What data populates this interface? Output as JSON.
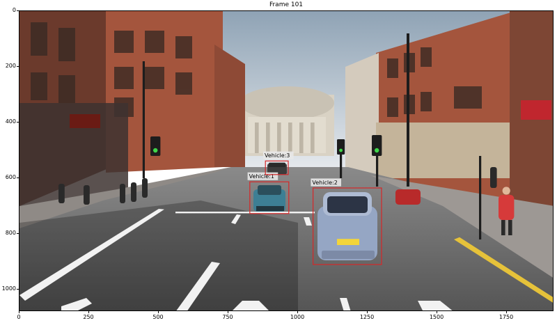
{
  "title": "Frame 101",
  "image": {
    "width": 1920,
    "height": 1080,
    "description_semantic": "street-scene-frame"
  },
  "x_ticks": [
    {
      "value": 0,
      "label": "0"
    },
    {
      "value": 250,
      "label": "250"
    },
    {
      "value": 500,
      "label": "500"
    },
    {
      "value": 750,
      "label": "750"
    },
    {
      "value": 1000,
      "label": "1000"
    },
    {
      "value": 1250,
      "label": "1250"
    },
    {
      "value": 1500,
      "label": "1500"
    },
    {
      "value": 1750,
      "label": "1750"
    }
  ],
  "y_ticks": [
    {
      "value": 0,
      "label": "0"
    },
    {
      "value": 200,
      "label": "200"
    },
    {
      "value": 400,
      "label": "400"
    },
    {
      "value": 600,
      "label": "600"
    },
    {
      "value": 800,
      "label": "800"
    },
    {
      "value": 1000,
      "label": "1000"
    }
  ],
  "detections": [
    {
      "label": "Vehicle:1",
      "x1": 827,
      "y1": 613,
      "x2": 967,
      "y2": 727
    },
    {
      "label": "Vehicle:2",
      "x1": 1054,
      "y1": 635,
      "x2": 1300,
      "y2": 910
    },
    {
      "label": "Vehicle:3",
      "x1": 883,
      "y1": 538,
      "x2": 965,
      "y2": 587
    }
  ],
  "colors": {
    "box": "#d62728",
    "label_bg": "#e8e8e8",
    "sky": "#cfd6dc",
    "road": "#6f6f6f",
    "brick": "#9a4b38"
  }
}
